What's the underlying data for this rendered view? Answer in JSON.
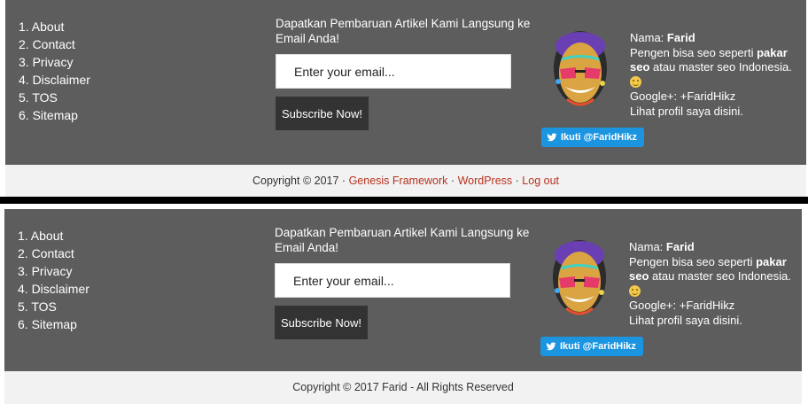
{
  "colors": {
    "footer_bg": "#5e5d5d",
    "button_bg": "#333333",
    "link": "#b8311e",
    "twitter": "#1b95e0"
  },
  "top": {
    "menu": [
      "1. About",
      "2. Contact",
      "3. Privacy",
      "4. Disclaimer",
      "5. TOS",
      "6. Sitemap"
    ],
    "subscribe_title": "Dapatkan Pembaruan Artikel Kami Langsung ke Email Anda!",
    "email_placeholder": "Enter your email...",
    "subscribe_button": "Subscribe Now!",
    "profile": {
      "name_label": "Nama:",
      "name": "Farid",
      "bio_pre": "Pengen bisa seo seperti",
      "bio_bold": "pakar seo",
      "bio_post": "atau master seo Indonesia.",
      "google": "Google+: +FaridHikz",
      "profile_link": "Lihat profil saya disini."
    },
    "twitter_button": "Ikuti @FaridHikz",
    "footer": {
      "copyright": "Copyright © 2017 ·",
      "links": [
        "Genesis Framework",
        "WordPress",
        "Log out"
      ],
      "separator": "·"
    }
  },
  "bottom": {
    "menu": [
      "1. About",
      "2. Contact",
      "3. Privacy",
      "4. Disclaimer",
      "5. TOS",
      "6. Sitemap"
    ],
    "subscribe_title": "Dapatkan Pembaruan Artikel Kami Langsung ke Email Anda!",
    "email_placeholder": "Enter your email...",
    "subscribe_button": "Subscribe Now!",
    "profile": {
      "name_label": "Nama:",
      "name": "Farid",
      "bio_pre": "Pengen bisa seo seperti",
      "bio_bold": "pakar seo",
      "bio_post": "atau master seo Indonesia.",
      "google": "Google+: +FaridHikz",
      "profile_link": "Lihat profil saya disini."
    },
    "twitter_button": "Ikuti @FaridHikz",
    "footer": {
      "copyright": "Copyright © 2017 Farid - All Rights Reserved"
    }
  }
}
